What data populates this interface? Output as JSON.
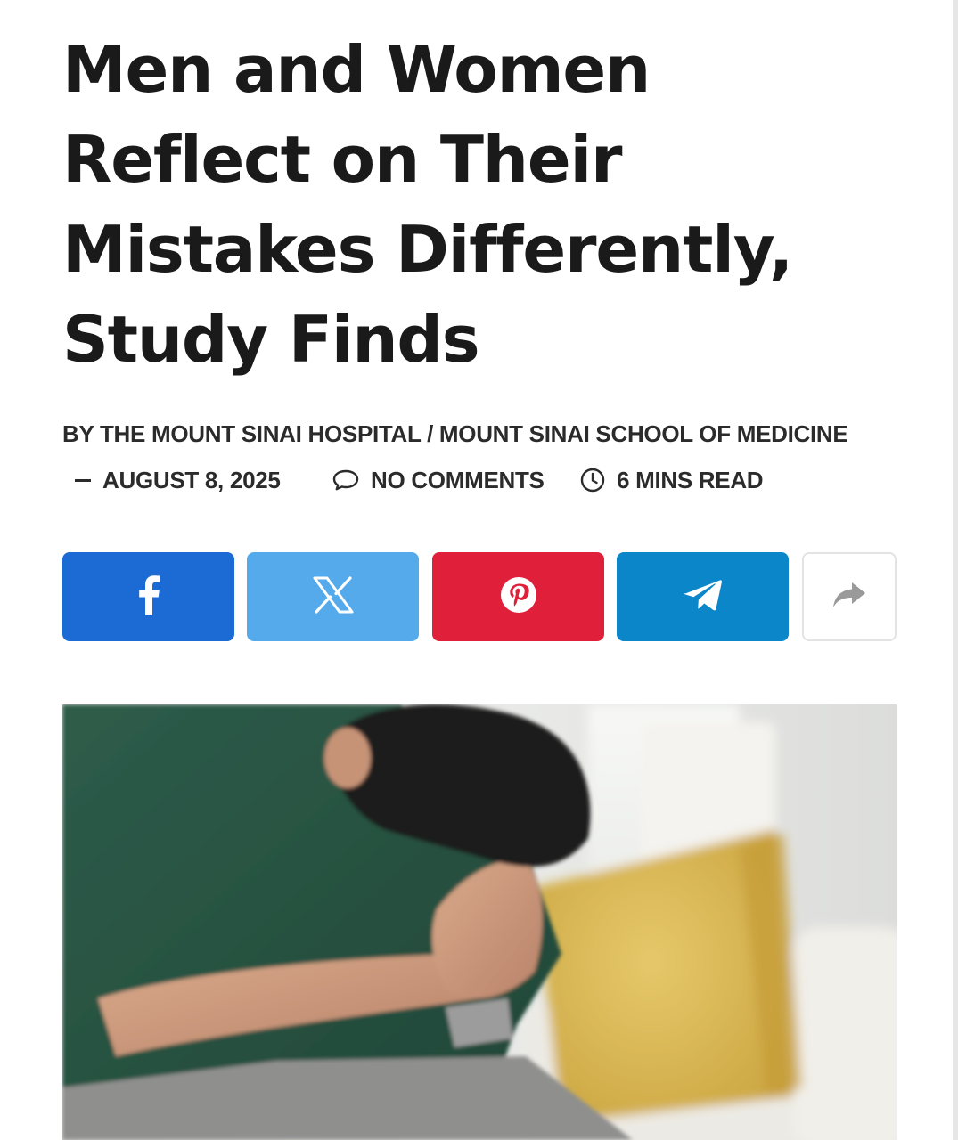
{
  "article": {
    "title_lines": [
      "Men and Women",
      "Reflect on Their",
      "Mistakes Differently,",
      "Study Finds"
    ],
    "byline": "BY THE MOUNT SINAI HOSPITAL / MOUNT SINAI SCHOOL OF MEDICINE",
    "date": "AUGUST 8, 2025",
    "comments": "NO COMMENTS",
    "read_time": "6 MINS READ"
  },
  "share": {
    "buttons": [
      {
        "network": "facebook",
        "icon": "facebook-icon",
        "color": "#1c6bd4"
      },
      {
        "network": "x",
        "icon": "x-icon",
        "color": "#55aaec"
      },
      {
        "network": "pinterest",
        "icon": "pinterest-icon",
        "color": "#e0203a"
      },
      {
        "network": "telegram",
        "icon": "telegram-icon",
        "color": "#0b87c9"
      }
    ],
    "more_icon": "share-forward-icon"
  },
  "hero_image": {
    "subject": "young man in green t-shirt sitting with head bowed on clasped hands, yellow cushion on white sofa behind"
  },
  "colors": {
    "text": "#1a1a1a",
    "meta_text": "#2b2b2b",
    "more_border": "#e3e3e3"
  }
}
